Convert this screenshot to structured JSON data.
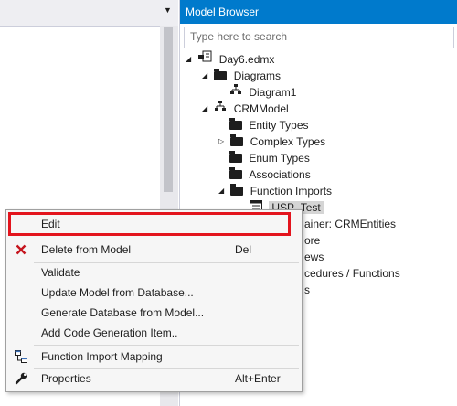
{
  "model_browser": {
    "title": "Model Browser",
    "search_placeholder": "Type here to search"
  },
  "tree": {
    "root": "Day6.edmx",
    "diagrams": "Diagrams",
    "diagram1": "Diagram1",
    "model": "CRMModel",
    "entity_types": "Entity Types",
    "complex_types": "Complex Types",
    "enum_types": "Enum Types",
    "associations": "Associations",
    "function_imports": "Function Imports",
    "usp_test": "USP_Test",
    "entity_container": "ainer: CRMEntities",
    "store": "ore",
    "views": "ews",
    "stored_procedures": "cedures / Functions",
    "tables": "s"
  },
  "context_menu": {
    "edit": "Edit",
    "delete": "Delete from Model",
    "delete_shortcut": "Del",
    "validate": "Validate",
    "update_model": "Update Model from Database...",
    "generate_db": "Generate Database from Model...",
    "add_code_gen": "Add Code Generation Item..",
    "function_import_mapping": "Function Import Mapping",
    "properties": "Properties",
    "properties_shortcut": "Alt+Enter"
  },
  "colors": {
    "accent": "#007acc",
    "highlight_border": "#e3141d",
    "delete_icon": "#c5141d"
  },
  "icons": {
    "delete": "delete-x-icon",
    "mapping": "mapping-icon",
    "properties": "wrench-icon"
  }
}
